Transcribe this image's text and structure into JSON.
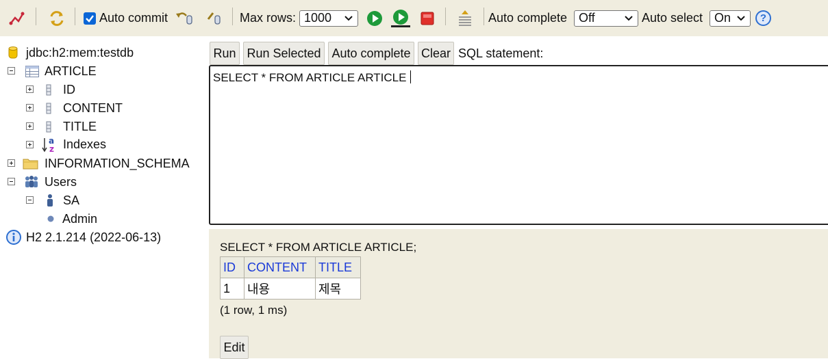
{
  "toolbar": {
    "auto_commit_label": "Auto commit",
    "auto_commit_checked": true,
    "max_rows_label": "Max rows:",
    "max_rows_value": "1000",
    "auto_complete_label": "Auto complete",
    "auto_complete_value": "Off",
    "auto_select_label": "Auto select",
    "auto_select_value": "On",
    "help_glyph": "?",
    "icons": [
      "disconnect-icon",
      "refresh-icon",
      "rollback-icon",
      "commit-icon",
      "run-icon",
      "run-selected-icon",
      "stop-icon",
      "history-icon",
      "help-icon"
    ]
  },
  "tree": {
    "connection": "jdbc:h2:mem:testdb",
    "table": "ARTICLE",
    "columns": [
      "ID",
      "CONTENT",
      "TITLE"
    ],
    "indexes_label": "Indexes",
    "schema": "INFORMATION_SCHEMA",
    "users_label": "Users",
    "user": "SA",
    "user_role": "Admin",
    "version": "H2 2.1.214 (2022-06-13)"
  },
  "query_panel": {
    "run_label": "Run",
    "run_selected_label": "Run Selected",
    "auto_complete_label": "Auto complete",
    "clear_label": "Clear",
    "sql_statement_label": "SQL statement:",
    "sql_text": "SELECT * FROM ARTICLE ARTICLE"
  },
  "results": {
    "query_echo": "SELECT * FROM ARTICLE ARTICLE;",
    "headers": [
      "ID",
      "CONTENT",
      "TITLE"
    ],
    "rows": [
      [
        "1",
        "내용",
        "제목"
      ]
    ],
    "summary": "(1 row, 1 ms)",
    "edit_label": "Edit"
  },
  "colors": {
    "toolbar_bg": "#f0eddf",
    "header_link": "#1a3ad8",
    "run_green": "#1e9a3a",
    "stop_red": "#e0302a",
    "checkbox_blue": "#0b66d6"
  }
}
